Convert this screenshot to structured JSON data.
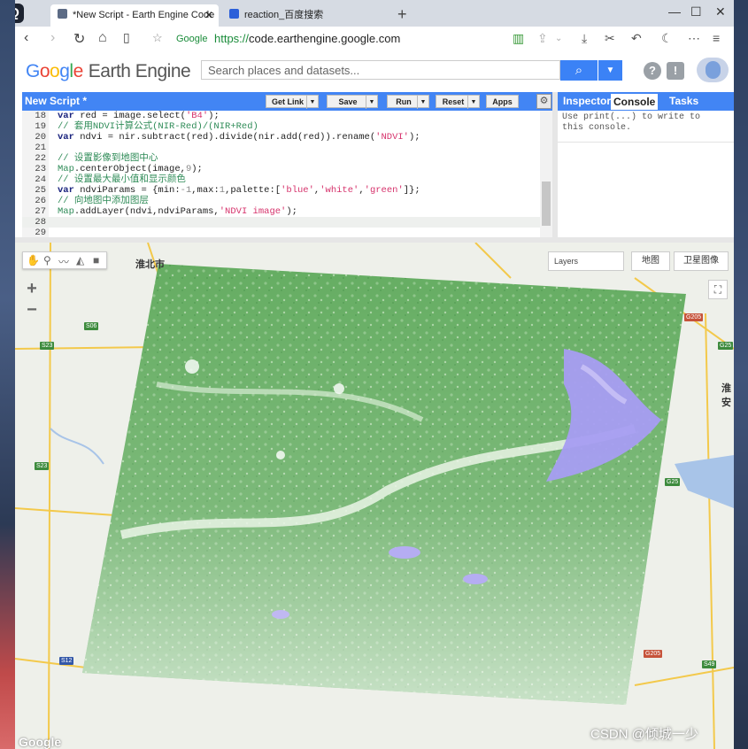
{
  "browser": {
    "tabs": [
      {
        "title": "*New Script - Earth Engine Code",
        "active": true
      },
      {
        "title": "reaction_百度搜索",
        "active": false
      }
    ],
    "address": {
      "site_label": "Google",
      "url_scheme": "https://",
      "url_host": "code.earthengine.google.com"
    }
  },
  "gee": {
    "logo_google": "Google",
    "logo_product": "Earth Engine",
    "search_placeholder": "Search places and datasets...",
    "editor": {
      "title": "New Script *",
      "buttons": {
        "get_link": "Get Link",
        "save": "Save",
        "run": "Run",
        "reset": "Reset",
        "apps": "Apps"
      },
      "lines": [
        {
          "n": "18",
          "t": "var red = image.select('B4');"
        },
        {
          "n": "19",
          "t": "// 套用NDVI计算公式(NIR-Red)/(NIR+Red)"
        },
        {
          "n": "20",
          "t": "var ndvi = nir.subtract(red).divide(nir.add(red)).rename('NDVI');"
        },
        {
          "n": "21",
          "t": ""
        },
        {
          "n": "22",
          "t": "// 设置影像到地图中心"
        },
        {
          "n": "23",
          "t": "Map.centerObject(image,9);"
        },
        {
          "n": "24",
          "t": "// 设置最大最小值和显示颜色"
        },
        {
          "n": "25",
          "t": "var ndviParams = {min:-1,max:1,palette:['blue','white','green']};"
        },
        {
          "n": "26",
          "t": "// 向地图中添加图层"
        },
        {
          "n": "27",
          "t": "Map.addLayer(ndvi,ndviParams,'NDVI image');"
        },
        {
          "n": "28",
          "t": ""
        },
        {
          "n": "29",
          "t": ""
        }
      ]
    },
    "right_panel": {
      "tabs": {
        "inspector": "Inspector",
        "console": "Console",
        "tasks": "Tasks"
      },
      "console_message": "Use print(...) to write to this console."
    },
    "map": {
      "layers_label": "Layers",
      "map_type": "地图",
      "satellite_type": "卫星图像",
      "cities": {
        "huaibei": "淮北市",
        "huaian": "淮安"
      },
      "brand": "Google",
      "watermark": "CSDN @倾城一少",
      "colors": {
        "ndvi_green": "#5aa95a",
        "ndvi_white": "#f4f8f2",
        "ndvi_blue": "#a79df2"
      }
    }
  }
}
